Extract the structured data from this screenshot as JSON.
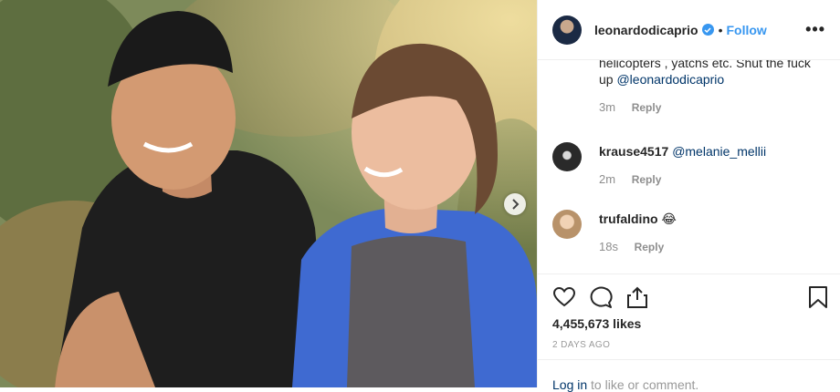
{
  "header": {
    "username": "leonardodicaprio",
    "separator": "•",
    "follow_label": "Follow",
    "more_label": "•••"
  },
  "comments": {
    "continuation": {
      "text_line1": "helicopters , yatchs etc. Shut the fuck",
      "text_line2_prefix": "up ",
      "mention": "@leonardodicaprio",
      "time": "3m",
      "reply_label": "Reply"
    },
    "items": [
      {
        "username": "krause4517",
        "mention": "@melanie_mellii",
        "text": "",
        "time": "2m",
        "reply_label": "Reply"
      },
      {
        "username": "trufaldino",
        "mention": "",
        "text": "😂",
        "time": "18s",
        "reply_label": "Reply"
      }
    ]
  },
  "actions": {
    "likes": "4,455,673 likes",
    "age": "2 DAYS AGO"
  },
  "login": {
    "link_label": "Log in",
    "suffix": " to like or comment."
  },
  "colors": {
    "accent": "#3897f0",
    "link": "#003569",
    "muted": "#8e8e8e",
    "border": "#efefef"
  },
  "icons": [
    "heart-icon",
    "comment-icon",
    "share-icon",
    "bookmark-icon",
    "chevron-right-icon",
    "verified-icon"
  ]
}
